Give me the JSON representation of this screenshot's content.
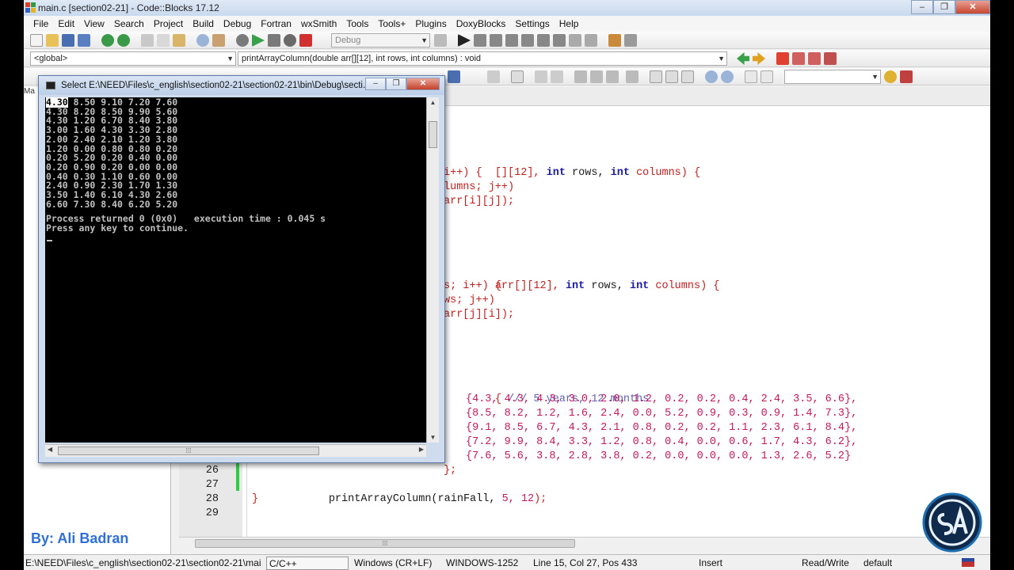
{
  "window": {
    "title": "main.c [section02-21] - Code::Blocks 17.12"
  },
  "menu": [
    "File",
    "Edit",
    "View",
    "Search",
    "Project",
    "Build",
    "Debug",
    "Fortran",
    "wxSmith",
    "Tools",
    "Tools+",
    "Plugins",
    "DoxyBlocks",
    "Settings",
    "Help"
  ],
  "toolbar": {
    "build_target": "Debug",
    "scope": "<global>",
    "function": "printArrayColumn(double arr[][12], int rows, int columns) : void"
  },
  "left_pane": {
    "tab_label": "Ma",
    "author": "By: Ali Badran"
  },
  "console": {
    "title": "Select E:\\NEED\\Files\\c_english\\section02-21\\section02-21\\bin\\Debug\\secti...",
    "first_value": "4.30",
    "first_rest": " 8.50 9.10 7.20 7.60",
    "lines": [
      "4.30 8.20 8.50 9.90 5.60",
      "4.30 1.20 6.70 8.40 3.80",
      "3.00 1.60 4.30 3.30 2.80",
      "2.00 2.40 2.10 1.20 3.80",
      "1.20 0.00 0.80 0.80 0.20",
      "0.20 5.20 0.20 0.40 0.00",
      "0.20 0.90 0.20 0.00 0.00",
      "0.40 0.30 1.10 0.60 0.00",
      "2.40 0.90 2.30 1.70 1.30",
      "3.50 1.40 6.10 4.30 2.60",
      "6.60 7.30 8.40 6.20 5.20"
    ],
    "process_line": "Process returned 0 (0x0)   execution time : 0.045 s",
    "continue_line": "Press any key to continue."
  },
  "code": {
    "line_a": [
      {
        "t": "[][12], ",
        "c": "op"
      },
      {
        "t": "int",
        "c": "kw"
      },
      {
        "t": " rows, ",
        "c": "tx"
      },
      {
        "t": "int",
        "c": "kw"
      },
      {
        "t": " columns) {",
        "c": "op"
      }
    ],
    "line_b": "i++) {",
    "line_c": "lumns; j++)",
    "line_d": "arr[i][j]);",
    "line_e": [
      {
        "t": "arr[][12], ",
        "c": "op"
      },
      {
        "t": "int",
        "c": "kw"
      },
      {
        "t": " rows, ",
        "c": "tx"
      },
      {
        "t": "int",
        "c": "kw"
      },
      {
        "t": " columns) {",
        "c": "op"
      }
    ],
    "line_f": "s; i++) {",
    "line_g": "ws; j++)",
    "line_h": "arr[j][i]);",
    "line_i_brace": "{ ",
    "line_i_comment": "/// 5 years, 12 months",
    "rain_rows": [
      "{4.3, 4.3, 4.3, 3.0, 2.0, 1.2, 0.2, 0.2, 0.4, 2.4, 3.5, 6.6},",
      "{8.5, 8.2, 1.2, 1.6, 2.4, 0.0, 5.2, 0.9, 0.3, 0.9, 1.4, 7.3},",
      "{9.1, 8.5, 6.7, 4.3, 2.1, 0.8, 0.2, 0.2, 1.1, 2.3, 6.1, 8.4},",
      "{7.2, 9.9, 8.4, 3.3, 1.2, 0.8, 0.4, 0.0, 0.6, 1.7, 4.3, 6.2},",
      "{7.6, 5.6, 3.8, 2.8, 3.8, 0.2, 0.0, 0.0, 0.0, 1.3, 2.6, 5.2}"
    ],
    "close_array": "};",
    "call_name": "printArrayColumn(rainFall, ",
    "call_args": "5, 12",
    "call_end": ");",
    "close_brace": "}",
    "line_numbers": [
      "26",
      "27",
      "28",
      "29"
    ]
  },
  "status": {
    "path": "E:\\NEED\\Files\\c_english\\section02-21\\section02-21\\main.c",
    "language": "C/C++",
    "eol": "Windows (CR+LF)",
    "encoding": "WINDOWS-1252",
    "position": "Line 15, Col 27, Pos 433",
    "mode": "Insert",
    "access": "Read/Write",
    "profile": "default"
  },
  "colors": {
    "keyword": "#1a1aa6",
    "operator": "#c02020",
    "number": "#c2185b",
    "comment": "#6060b0",
    "author": "#2f6fd6"
  }
}
